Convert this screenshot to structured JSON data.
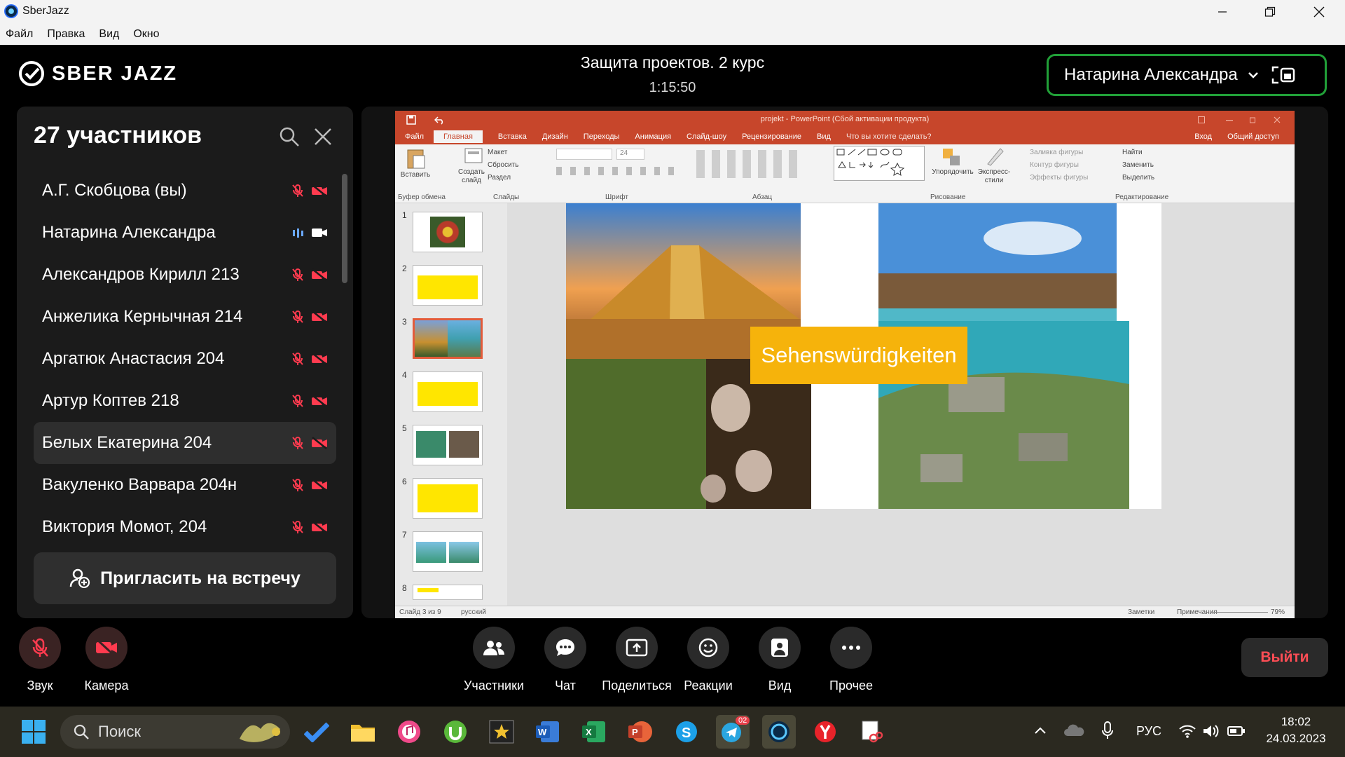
{
  "window": {
    "app_title": "SberJazz"
  },
  "menubar": [
    "Файл",
    "Правка",
    "Вид",
    "Окно"
  ],
  "header": {
    "logo": "SBER JAZZ",
    "meeting_title": "Защита проектов. 2 курс",
    "timer": "1:15:50",
    "active_speaker": "Натарина Александра"
  },
  "sidebar": {
    "title": "27 участников",
    "participants": [
      {
        "name": "А.Г. Скобцова (вы)",
        "mic": "muted",
        "cam": "off"
      },
      {
        "name": "Натарина Александра",
        "mic": "speaking",
        "cam": "on"
      },
      {
        "name": "Александров Кирилл 213",
        "mic": "muted",
        "cam": "off"
      },
      {
        "name": "Анжелика Кернычная 214",
        "mic": "muted",
        "cam": "off"
      },
      {
        "name": "Аргатюк Анастасия 204",
        "mic": "muted",
        "cam": "off"
      },
      {
        "name": "Артур Коптев 218",
        "mic": "muted",
        "cam": "off"
      },
      {
        "name": "Белых Екатерина 204",
        "mic": "muted",
        "cam": "off"
      },
      {
        "name": "Вакуленко Варвара 204н",
        "mic": "muted",
        "cam": "off"
      },
      {
        "name": "Виктория Момот, 204",
        "mic": "muted",
        "cam": "off"
      }
    ],
    "invite_label": "Пригласить на встречу"
  },
  "powerpoint": {
    "title": "projekt - PowerPoint (Сбой активации продукта)",
    "tabs": [
      "Файл",
      "Главная",
      "Вставка",
      "Дизайн",
      "Переходы",
      "Анимация",
      "Слайд-шоу",
      "Рецензирование",
      "Вид"
    ],
    "tell_me": "Что вы хотите сделать?",
    "sign_in": "Вход",
    "share": "Общий доступ",
    "ribbon": {
      "paste": "Вставить",
      "create_slide": "Создать слайд",
      "layout": "Макет",
      "reset": "Сбросить",
      "section": "Раздел",
      "font_size": "24",
      "arrange": "Упорядочить",
      "quick_styles": "Экспресс-стили",
      "shape_fill": "Заливка фигуры",
      "shape_outline": "Контур фигуры",
      "shape_effects": "Эффекты фигуры",
      "find": "Найти",
      "replace": "Заменить",
      "select": "Выделить",
      "groups": [
        "Буфер обмена",
        "Слайды",
        "Шрифт",
        "Абзац",
        "Рисование",
        "Редактирование"
      ]
    },
    "thumbnails": [
      "1",
      "2",
      "3",
      "4",
      "5",
      "6",
      "7",
      "8"
    ],
    "selected_slide": 3,
    "slide_heading": "Sehenswürdigkeiten",
    "status": {
      "slide": "Слайд 3 из 9",
      "language": "русский",
      "notes": "Заметки",
      "comments": "Примечания",
      "zoom": "79%"
    }
  },
  "controls": [
    {
      "id": "sound",
      "label": "Звук"
    },
    {
      "id": "camera",
      "label": "Камера"
    },
    {
      "id": "participants",
      "label": "Участники"
    },
    {
      "id": "chat",
      "label": "Чат"
    },
    {
      "id": "share",
      "label": "Поделиться"
    },
    {
      "id": "reactions",
      "label": "Реакции"
    },
    {
      "id": "view",
      "label": "Вид"
    },
    {
      "id": "more",
      "label": "Прочее"
    }
  ],
  "exit_label": "Выйти",
  "taskbar": {
    "search": "Поиск",
    "telegram_badge": "02",
    "lang": "РУС",
    "time": "18:02",
    "date": "24.03.2023"
  },
  "colors": {
    "accent_green": "#21a038",
    "muted_red": "#ff3b4f",
    "ppt_orange": "#c7462b",
    "exit_red": "#ff4d55"
  }
}
